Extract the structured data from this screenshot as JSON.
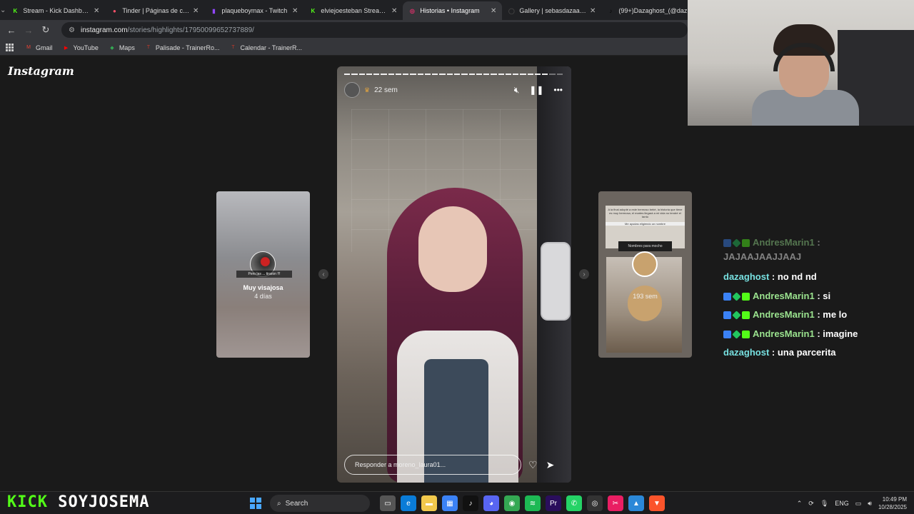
{
  "browser": {
    "tabs": [
      {
        "title": "Stream - Kick Dashboard",
        "icon": "kick-icon",
        "color": "#53fc18",
        "glyph": "K"
      },
      {
        "title": "Tinder | Páginas de citas",
        "icon": "tinder-icon",
        "color": "#fd5068",
        "glyph": "●"
      },
      {
        "title": "plaqueboymax - Twitch",
        "icon": "twitch-icon",
        "color": "#9146ff",
        "glyph": "▮"
      },
      {
        "title": "elviejoesteban Stream - W",
        "icon": "kick-icon",
        "color": "#53fc18",
        "glyph": "K"
      },
      {
        "title": "Historias • Instagram",
        "icon": "instagram-icon",
        "color": "#e1306c",
        "glyph": "◎"
      },
      {
        "title": "Gallery | sebasdazaa | VSC",
        "icon": "vsco-icon",
        "color": "#444444",
        "glyph": "◯"
      },
      {
        "title": "(99+)Dazaghost_(@daz",
        "icon": "tiktok-icon",
        "color": "#000000",
        "glyph": "♪"
      }
    ],
    "url_host": "instagram.com",
    "url_path": "/stories/highlights/17950099652737889/",
    "bookmarks": [
      {
        "label": "Gmail",
        "icon": "gmail-icon",
        "color": "#ea4335",
        "glyph": "M"
      },
      {
        "label": "YouTube",
        "icon": "youtube-icon",
        "color": "#ff0000",
        "glyph": "▶"
      },
      {
        "label": "Maps",
        "icon": "maps-icon",
        "color": "#34a853",
        "glyph": "◆"
      },
      {
        "label": "Palisade - TrainerRo...",
        "icon": "trainer-icon",
        "color": "#c0392b",
        "glyph": "T"
      },
      {
        "label": "Calendar - TrainerR...",
        "icon": "trainer-icon",
        "color": "#c0392b",
        "glyph": "T"
      }
    ]
  },
  "instagram": {
    "logo": "Instagram",
    "story": {
      "time": "22 sem",
      "progress_total": 30,
      "progress_done": 28,
      "reply_placeholder": "Responder a moreno_laura01..."
    },
    "prev_story": {
      "name": "Muy visajosa",
      "sub": "4 días",
      "caption": "Pero las ... tiraron !!!"
    },
    "next_story": {
      "sub": "193 sem",
      "card_text": "A la final adopté a este hermoso bebé, la historia que tiene es muy hermosa, el martes llegará a mi vida no tendré el tanto",
      "card_subtext": "Me ayudas eligiendo un nombre",
      "label": "Nombres para mocho"
    }
  },
  "chat": [
    {
      "badges": true,
      "user": "AndresMarin1",
      "text": "JAJAAJAAJJAAJ",
      "user_class": "u-andres",
      "faded": true
    },
    {
      "badges": false,
      "user": "dazaghost",
      "text": "no nd nd",
      "user_class": "u-daza",
      "faded": false
    },
    {
      "badges": true,
      "user": "AndresMarin1",
      "text": "si",
      "user_class": "u-andres",
      "faded": false
    },
    {
      "badges": true,
      "user": "AndresMarin1",
      "text": "me lo",
      "user_class": "u-andres",
      "faded": false
    },
    {
      "badges": true,
      "user": "AndresMarin1",
      "text": "imagine",
      "user_class": "u-andres",
      "faded": false
    },
    {
      "badges": false,
      "user": "dazaghost",
      "text": "una parcerita",
      "user_class": "u-daza",
      "faded": false
    }
  ],
  "overlay": {
    "brand": "KICK",
    "username": "SOYJOSEMA"
  },
  "taskbar": {
    "search_label": "Search",
    "language": "ENG",
    "time": "10:49 PM",
    "date": "10/28/2025",
    "apps": [
      {
        "icon": "task-view-icon",
        "color": "#555555",
        "glyph": "▭"
      },
      {
        "icon": "edge-icon",
        "color": "#0a7cd8",
        "glyph": "e"
      },
      {
        "icon": "file-explorer-icon",
        "color": "#f2c94c",
        "glyph": "▬"
      },
      {
        "icon": "store-icon",
        "color": "#3b82f6",
        "glyph": "▦"
      },
      {
        "icon": "tiktok-icon",
        "color": "#111111",
        "glyph": "♪"
      },
      {
        "icon": "discord-icon",
        "color": "#5865f2",
        "glyph": "◕"
      },
      {
        "icon": "chrome-icon",
        "color": "#34a853",
        "glyph": "◉"
      },
      {
        "icon": "spotify-icon",
        "color": "#1db954",
        "glyph": "≋"
      },
      {
        "icon": "premiere-icon",
        "color": "#2a0e5c",
        "glyph": "Pr"
      },
      {
        "icon": "whatsapp-icon",
        "color": "#25d366",
        "glyph": "✆"
      },
      {
        "icon": "obs-icon",
        "color": "#333333",
        "glyph": "◎"
      },
      {
        "icon": "capcut-icon",
        "color": "#e91e63",
        "glyph": "✂"
      },
      {
        "icon": "photos-icon",
        "color": "#2b88d8",
        "glyph": "▲"
      },
      {
        "icon": "brave-icon",
        "color": "#fb542b",
        "glyph": "▼"
      }
    ]
  }
}
